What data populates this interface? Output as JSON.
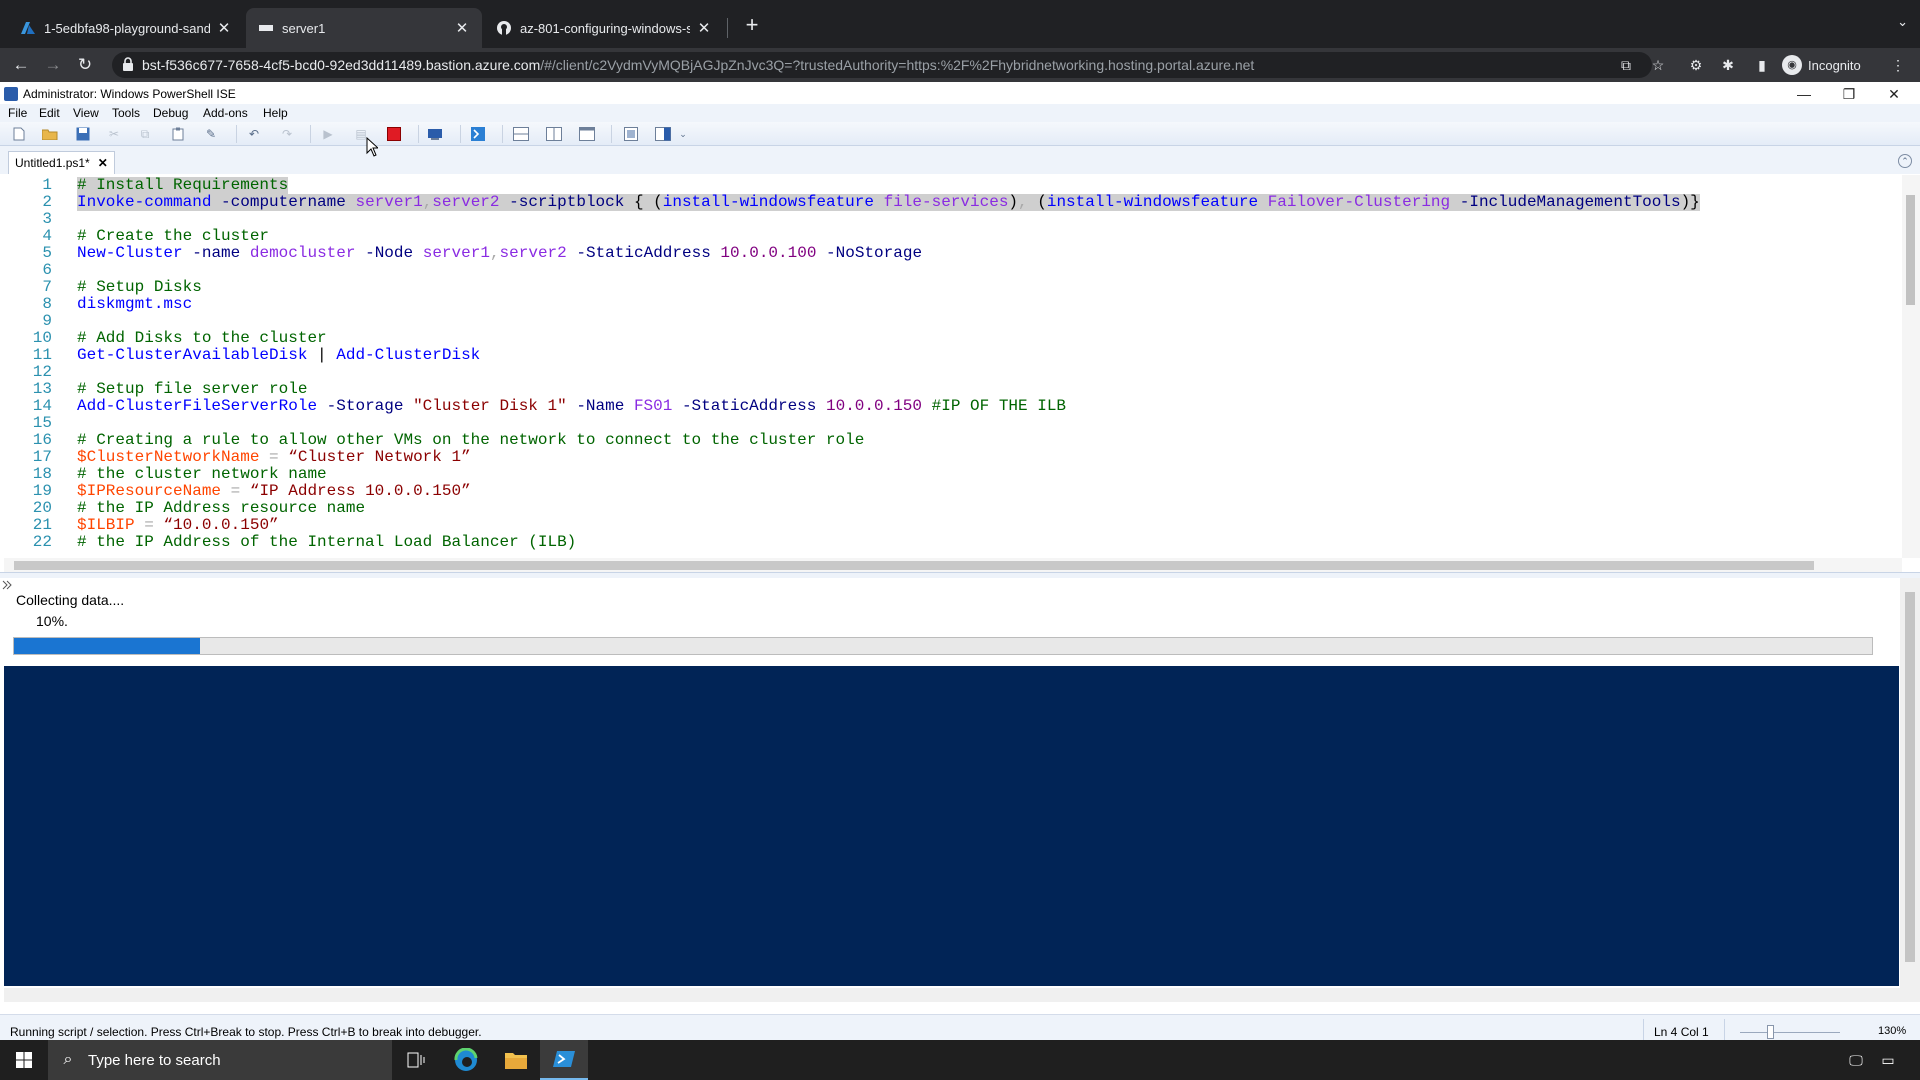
{
  "browser": {
    "tabs": [
      {
        "title": "1-5edbfa98-playground-sandb",
        "icon": "azure-logo-icon"
      },
      {
        "title": "server1",
        "icon": "bastion-icon"
      },
      {
        "title": "az-801-configuring-windows-s",
        "icon": "github-icon"
      }
    ],
    "url_host": "bst-f536c677-7658-4cf5-bcd0-92ed3dd11489.bastion.azure.com",
    "url_rest": "/#/client/c2VydmVyMQBjAGJpZnJvc3Q=?trustedAuthority=https:%2F%2Fhybridnetworking.hosting.portal.azure.net",
    "incognito_label": "Incognito"
  },
  "ise": {
    "title": "Administrator: Windows PowerShell ISE",
    "menu": [
      "File",
      "Edit",
      "View",
      "Tools",
      "Debug",
      "Add-ons",
      "Help"
    ],
    "script_tab": "Untitled1.ps1*",
    "lines": [
      {
        "n": "1",
        "sel": true,
        "tokens": [
          {
            "c": "cm",
            "t": "# Install Requirements"
          }
        ]
      },
      {
        "n": "2",
        "sel": true,
        "tokens": [
          {
            "c": "cmd",
            "t": "Invoke-command"
          },
          {
            "c": "pl",
            "t": " "
          },
          {
            "c": "prm",
            "t": "-computername"
          },
          {
            "c": "pl",
            "t": " "
          },
          {
            "c": "arg",
            "t": "server1"
          },
          {
            "c": "op",
            "t": ","
          },
          {
            "c": "arg",
            "t": "server2"
          },
          {
            "c": "pl",
            "t": " "
          },
          {
            "c": "prm",
            "t": "-scriptblock"
          },
          {
            "c": "pl",
            "t": " { ("
          },
          {
            "c": "cmd",
            "t": "install-windowsfeature"
          },
          {
            "c": "pl",
            "t": " "
          },
          {
            "c": "arg",
            "t": "file-services"
          },
          {
            "c": "pl",
            "t": ")"
          },
          {
            "c": "op",
            "t": ","
          },
          {
            "c": "pl",
            "t": " ("
          },
          {
            "c": "cmd",
            "t": "install-windowsfeature"
          },
          {
            "c": "pl",
            "t": " "
          },
          {
            "c": "arg",
            "t": "Failover-Clustering"
          },
          {
            "c": "pl",
            "t": " "
          },
          {
            "c": "prm",
            "t": "-IncludeManagementTools"
          },
          {
            "c": "pl",
            "t": ")}"
          }
        ]
      },
      {
        "n": "3",
        "sel": false,
        "tokens": []
      },
      {
        "n": "4",
        "sel": false,
        "tokens": [
          {
            "c": "cm",
            "t": "# Create the cluster"
          }
        ]
      },
      {
        "n": "5",
        "sel": false,
        "tokens": [
          {
            "c": "cmd",
            "t": "New-Cluster"
          },
          {
            "c": "pl",
            "t": " "
          },
          {
            "c": "prm",
            "t": "-name"
          },
          {
            "c": "pl",
            "t": " "
          },
          {
            "c": "arg",
            "t": "democluster"
          },
          {
            "c": "pl",
            "t": " "
          },
          {
            "c": "prm",
            "t": "-Node"
          },
          {
            "c": "pl",
            "t": " "
          },
          {
            "c": "arg",
            "t": "server1"
          },
          {
            "c": "op",
            "t": ","
          },
          {
            "c": "arg",
            "t": "server2"
          },
          {
            "c": "pl",
            "t": " "
          },
          {
            "c": "prm",
            "t": "-StaticAddress"
          },
          {
            "c": "pl",
            "t": " "
          },
          {
            "c": "num",
            "t": "10.0.0.100"
          },
          {
            "c": "pl",
            "t": " "
          },
          {
            "c": "prm",
            "t": "-NoStorage"
          }
        ]
      },
      {
        "n": "6",
        "sel": false,
        "tokens": []
      },
      {
        "n": "7",
        "sel": false,
        "tokens": [
          {
            "c": "cm",
            "t": "# Setup Disks"
          }
        ]
      },
      {
        "n": "8",
        "sel": false,
        "tokens": [
          {
            "c": "cmd",
            "t": "diskmgmt.msc"
          }
        ]
      },
      {
        "n": "9",
        "sel": false,
        "tokens": []
      },
      {
        "n": "10",
        "sel": false,
        "tokens": [
          {
            "c": "cm",
            "t": "# Add Disks to the cluster"
          }
        ]
      },
      {
        "n": "11",
        "sel": false,
        "tokens": [
          {
            "c": "cmd",
            "t": "Get-ClusterAvailableDisk"
          },
          {
            "c": "pl",
            "t": " | "
          },
          {
            "c": "cmd",
            "t": "Add-ClusterDisk"
          }
        ]
      },
      {
        "n": "12",
        "sel": false,
        "tokens": []
      },
      {
        "n": "13",
        "sel": false,
        "tokens": [
          {
            "c": "cm",
            "t": "# Setup file server role"
          }
        ]
      },
      {
        "n": "14",
        "sel": false,
        "tokens": [
          {
            "c": "cmd",
            "t": "Add-ClusterFileServerRole"
          },
          {
            "c": "pl",
            "t": " "
          },
          {
            "c": "prm",
            "t": "-Storage"
          },
          {
            "c": "pl",
            "t": " "
          },
          {
            "c": "str",
            "t": "\"Cluster Disk 1\""
          },
          {
            "c": "pl",
            "t": " "
          },
          {
            "c": "prm",
            "t": "-Name"
          },
          {
            "c": "pl",
            "t": " "
          },
          {
            "c": "arg",
            "t": "FS01"
          },
          {
            "c": "pl",
            "t": " "
          },
          {
            "c": "prm",
            "t": "-StaticAddress"
          },
          {
            "c": "pl",
            "t": " "
          },
          {
            "c": "num",
            "t": "10.0.0.150"
          },
          {
            "c": "pl",
            "t": " "
          },
          {
            "c": "cm",
            "t": "#IP OF THE ILB"
          }
        ]
      },
      {
        "n": "15",
        "sel": false,
        "tokens": []
      },
      {
        "n": "16",
        "sel": false,
        "tokens": [
          {
            "c": "cm",
            "t": "# Creating a rule to allow other VMs on the network to connect to the cluster role"
          }
        ]
      },
      {
        "n": "17",
        "sel": false,
        "tokens": [
          {
            "c": "var",
            "t": "$ClusterNetworkName"
          },
          {
            "c": "op",
            "t": " = "
          },
          {
            "c": "str",
            "t": "“Cluster Network 1”"
          }
        ]
      },
      {
        "n": "18",
        "sel": false,
        "tokens": [
          {
            "c": "cm",
            "t": "# the cluster network name"
          }
        ]
      },
      {
        "n": "19",
        "sel": false,
        "tokens": [
          {
            "c": "var",
            "t": "$IPResourceName"
          },
          {
            "c": "op",
            "t": " = "
          },
          {
            "c": "str",
            "t": "“IP Address 10.0.0.150”"
          }
        ]
      },
      {
        "n": "20",
        "sel": false,
        "tokens": [
          {
            "c": "cm",
            "t": "# the IP Address resource name"
          }
        ]
      },
      {
        "n": "21",
        "sel": false,
        "tokens": [
          {
            "c": "var",
            "t": "$ILBIP"
          },
          {
            "c": "op",
            "t": " = "
          },
          {
            "c": "str",
            "t": "“10.0.0.150”"
          }
        ]
      },
      {
        "n": "22",
        "sel": false,
        "tokens": [
          {
            "c": "cm",
            "t": "# the IP Address of the Internal Load Balancer (ILB)"
          }
        ]
      }
    ],
    "progress": {
      "status": "Collecting data....",
      "percent_label": "10%.",
      "fraction": 0.1
    },
    "statusbar": {
      "message": "Running script / selection.  Press Ctrl+Break to stop.  Press Ctrl+B to break into debugger.",
      "position": "Ln 4  Col 1",
      "zoom": "130%"
    }
  },
  "taskbar": {
    "search_placeholder": "Type here to search"
  },
  "colors": {
    "console_bg": "#012456",
    "progress_fill": "#1a75d2",
    "browser_bg": "#202124"
  }
}
